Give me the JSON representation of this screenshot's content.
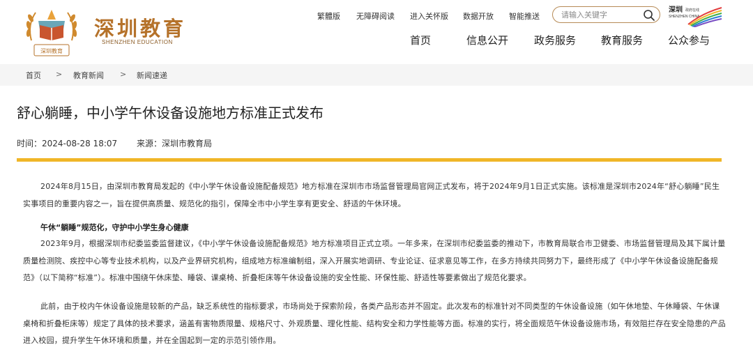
{
  "brand": {
    "name_cn": "深圳教育",
    "name_en": "SHENZHEN EDUCATION",
    "logo_text": "深圳教育"
  },
  "utility": [
    "繁體版",
    "无障碍阅读",
    "进入关怀版",
    "数据开放",
    "智能推送"
  ],
  "search": {
    "placeholder": "请输入关键字"
  },
  "sz_logo": {
    "text_cn": "深圳",
    "text_small": "政府在线",
    "text_en": "SHENZHEN CHINA"
  },
  "nav": [
    "首页",
    "信息公开",
    "政务服务",
    "教育服务",
    "公众参与"
  ],
  "breadcrumb": {
    "items": [
      "首页",
      "教育新闻",
      "新闻速递"
    ],
    "separator": ">"
  },
  "article": {
    "title": "舒心躺睡，中小学午休设备设施地方标准正式发布",
    "time": "时间：2024-08-28 18:07",
    "source": "来源：深圳市教育局",
    "p1": "2024年8月15日，由深圳市教育局发起的《中小学午休设备设施配备规范》地方标准在深圳市市场监督管理局官网正式发布，将于2024年9月1日正式实施。该标准是深圳市2024年“舒心躺睡”民生实事项目的重要内容之一，旨在提供高质量、规范化的指引，保障全市中小学生享有更安全、舒适的午休环境。",
    "subheading": "午休“躺睡”规范化，守护中小学生身心健康",
    "p2": "2023年9月，根据深圳市纪委监委监督建议，《中小学午休设备设施配备规范》地方标准项目正式立项。一年多来，在深圳市纪委监委的推动下，市教育局联合市卫健委、市场监督管理局及其下属计量质量检测院、疾控中心等专业技术机构，以及产业界研究机构，组成地方标准编制组，深入开展实地调研、专业论证、征求意见等工作，在多方持续共同努力下，最终形成了《中小学午休设备设施配备规范》（以下简称“标准”）。标准中围绕午休床垫、睡袋、课桌椅、折叠柜床等午休设备设施的安全性能、环保性能、舒适性等要素做出了规范化要求。",
    "p3": "此前，由于校内午休设备设施是较新的产品，缺乏系统性的指标要求，市场尚处于探索阶段，各类产品形态并不固定。此次发布的标准针对不同类型的午休设备设施（如午休地垫、午休睡袋、午休课桌椅和折叠柜床等）规定了具体的技术要求，涵盖有害物质限量、规格尺寸、外观质量、理化性能、结构安全和力学性能等方面。标准的实行，将全面规范午休设备设施市场，有效阻拦存在安全隐患的产品进入校园，提升学生午休环境和质量，并在全国起到一定的示范引领作用。"
  },
  "colors": {
    "accent": "#f0b628",
    "brand": "#b5722a",
    "crumb_bg": "#f5f5f5"
  }
}
